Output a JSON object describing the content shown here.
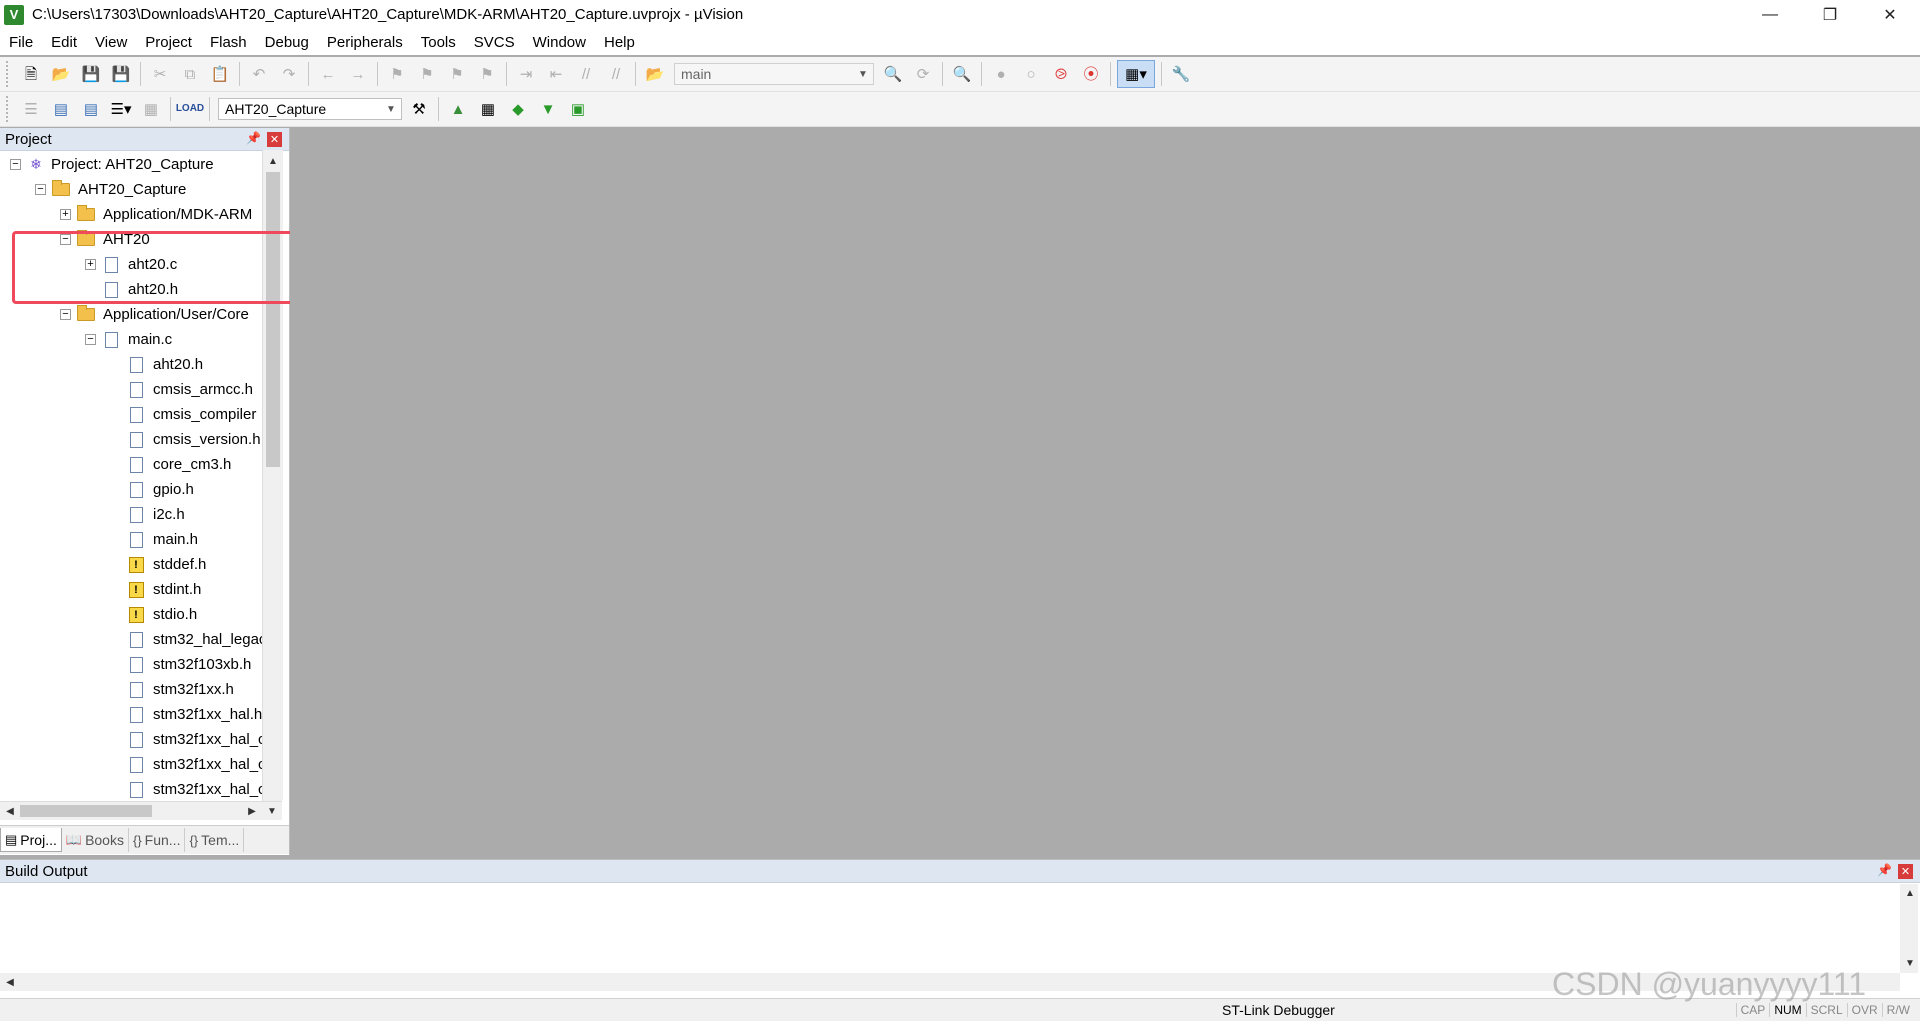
{
  "window": {
    "title": "C:\\Users\\17303\\Downloads\\AHT20_Capture\\AHT20_Capture\\MDK-ARM\\AHT20_Capture.uvprojx - µVision",
    "app_icon": "V"
  },
  "menu": [
    "File",
    "Edit",
    "View",
    "Project",
    "Flash",
    "Debug",
    "Peripherals",
    "Tools",
    "SVCS",
    "Window",
    "Help"
  ],
  "toolbar": {
    "find_combo_value": "main",
    "target_combo_value": "AHT20_Capture"
  },
  "project_panel": {
    "title": "Project"
  },
  "tree": {
    "root": "Project: AHT20_Capture",
    "target": "AHT20_Capture",
    "group_app_mdk": "Application/MDK-ARM",
    "group_aht20": "AHT20",
    "aht20_c": "aht20.c",
    "aht20_h": "aht20.h",
    "group_user_core": "Application/User/Core",
    "main_c": "main.c",
    "deps": [
      "aht20.h",
      "cmsis_armcc.h",
      "cmsis_compiler",
      "cmsis_version.h",
      "core_cm3.h",
      "gpio.h",
      "i2c.h",
      "main.h",
      "stddef.h",
      "stdint.h",
      "stdio.h",
      "stm32_hal_legac",
      "stm32f103xb.h",
      "stm32f1xx.h",
      "stm32f1xx_hal.h",
      "stm32f1xx_hal_c",
      "stm32f1xx_hal_c",
      "stm32f1xx_hal_c"
    ]
  },
  "panel_tabs": [
    "Proj...",
    "Books",
    "Fun...",
    "Tem..."
  ],
  "build_output": {
    "title": "Build Output"
  },
  "status": {
    "debugger": "ST-Link Debugger",
    "keys": [
      "CAP",
      "NUM",
      "SCRL",
      "OVR",
      "R/W"
    ]
  },
  "watermark": "CSDN @yuanyyyy111"
}
